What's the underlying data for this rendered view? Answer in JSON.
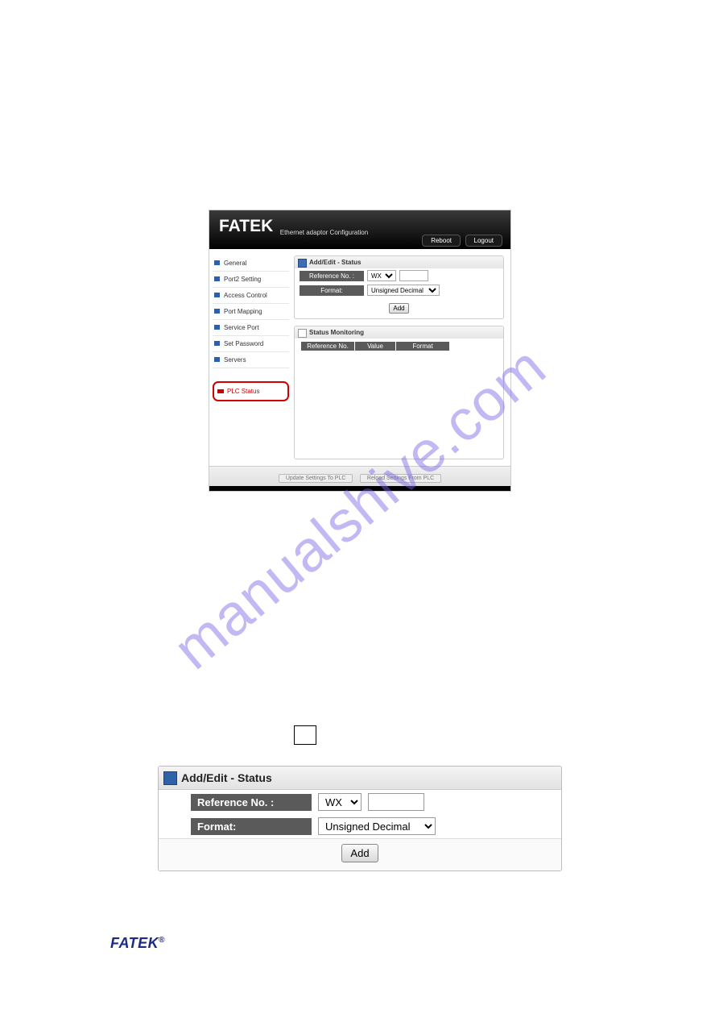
{
  "watermark": "manualshive.com",
  "panel": {
    "brand": "FATEK",
    "subtitle": "Ethernet adaptor Configuration",
    "buttons": {
      "reboot": "Reboot",
      "logout": "Logout"
    },
    "sidebar": {
      "items": [
        {
          "label": "General"
        },
        {
          "label": "Port2 Setting"
        },
        {
          "label": "Access Control"
        },
        {
          "label": "Port Mapping"
        },
        {
          "label": "Service Port"
        },
        {
          "label": "Set Password"
        },
        {
          "label": "Servers"
        }
      ],
      "plc_status": "PLC Status"
    },
    "addedit": {
      "title": "Add/Edit - Status",
      "ref_label": "Reference No. :",
      "ref_sel": "WX",
      "ref_txt": "",
      "fmt_label": "Format:",
      "fmt_sel": "Unsigned Decimal",
      "add_btn": "Add"
    },
    "monitor": {
      "title": "Status Monitoring",
      "cols": {
        "ref": "Reference No.",
        "val": "Value",
        "fmt": "Format"
      }
    },
    "footer": {
      "update": "Update Settings To PLC",
      "reload": "Reload Settings From PLC"
    }
  },
  "detail": {
    "title": "Add/Edit - Status",
    "ref_label": "Reference No. :",
    "ref_sel": "WX",
    "ref_txt": "",
    "fmt_label": "Format:",
    "fmt_sel": "Unsigned Decimal",
    "add_btn": "Add"
  },
  "footer_logo": "FATEK"
}
